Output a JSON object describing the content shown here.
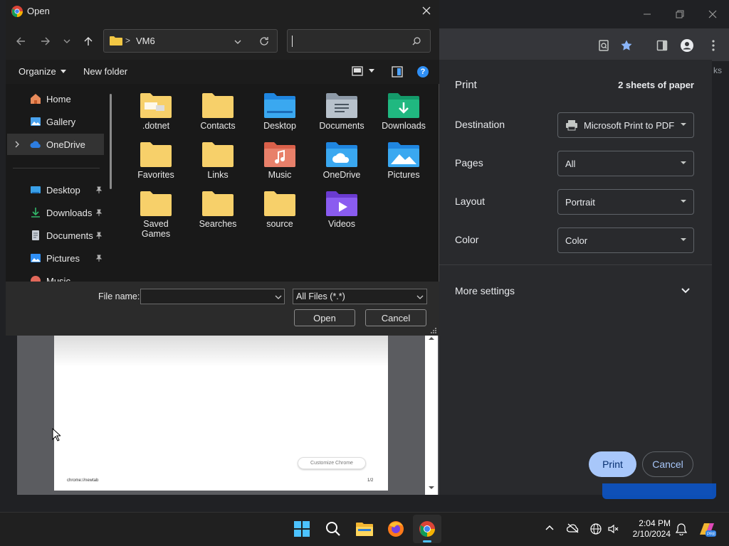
{
  "dialog": {
    "title": "Open",
    "breadcrumb_sep": ">",
    "address": "VM6",
    "search_placeholder": "",
    "organize": "Organize",
    "new_folder": "New folder",
    "help": "?",
    "sidebar": [
      {
        "label": "Home",
        "icon": "home-icon"
      },
      {
        "label": "Gallery",
        "icon": "gallery-icon"
      },
      {
        "label": "OneDrive",
        "icon": "cloud-icon"
      },
      {
        "label": "Desktop",
        "icon": "desktop-icon"
      },
      {
        "label": "Downloads",
        "icon": "download-icon"
      },
      {
        "label": "Documents",
        "icon": "document-icon"
      },
      {
        "label": "Pictures",
        "icon": "picture-icon"
      },
      {
        "label": "Music",
        "icon": "music-icon"
      }
    ],
    "folders": [
      {
        "label": ".dotnet"
      },
      {
        "label": "Contacts"
      },
      {
        "label": "Desktop"
      },
      {
        "label": "Documents"
      },
      {
        "label": "Downloads"
      },
      {
        "label": "Favorites"
      },
      {
        "label": "Links"
      },
      {
        "label": "Music"
      },
      {
        "label": "OneDrive"
      },
      {
        "label": "Pictures"
      },
      {
        "label": "Saved\nGames"
      },
      {
        "label": "Searches"
      },
      {
        "label": "source"
      },
      {
        "label": "Videos"
      }
    ],
    "file_name_label": "File name:",
    "file_name_value": "",
    "file_type": "All Files (*.*)",
    "open_button": "Open",
    "cancel_button": "Cancel"
  },
  "print": {
    "title": "Print",
    "sheets": "2 sheets of paper",
    "destination_label": "Destination",
    "destination_value": "Microsoft Print to PDF",
    "pages_label": "Pages",
    "pages_value": "All",
    "layout_label": "Layout",
    "layout_value": "Portrait",
    "color_label": "Color",
    "color_value": "Color",
    "more_settings": "More settings",
    "print_button": "Print",
    "cancel_button": "Cancel"
  },
  "preview": {
    "customize": "Customize Chrome",
    "footer_url": "chrome://newtab",
    "page_num": "1/2"
  },
  "toolbar_partial_text": "ks",
  "taskbar": {
    "time": "2:04 PM",
    "date": "2/10/2024"
  },
  "colors": {
    "accent_blue": "#8ab4f8",
    "print_btn_bg": "#a8c7fa",
    "print_btn_text": "#062e6f"
  }
}
